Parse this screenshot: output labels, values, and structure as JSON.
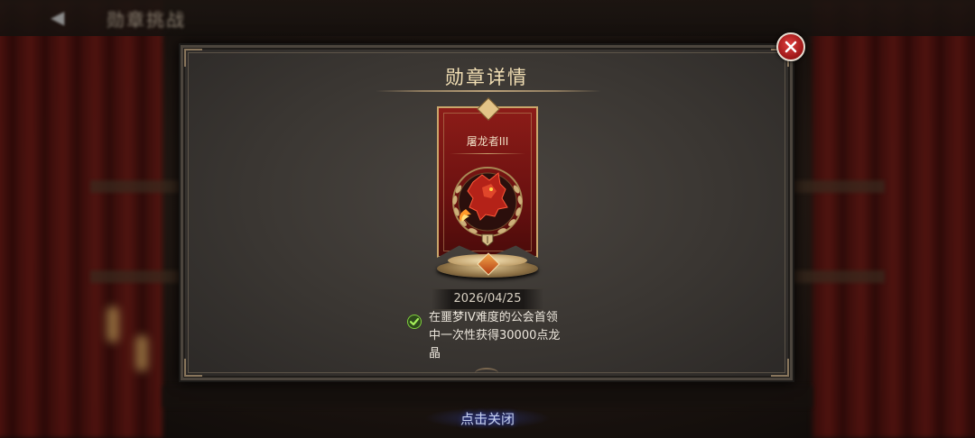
{
  "background": {
    "back_label": "◀",
    "page_title": "勋章挑战"
  },
  "dialog": {
    "title": "勋章详情",
    "close_icon": "close-icon",
    "medal": {
      "name": "屠龙者III",
      "emblem_icon": "red-dragon-emblem-icon"
    },
    "date": "2026/04/25",
    "condition": {
      "completed": true,
      "check_icon": "check-icon",
      "line1": "在噩梦IV难度的公会首领",
      "line2": "中一次性获得30000点龙",
      "line3": "晶"
    }
  },
  "footer": {
    "tap_to_close": "点击关闭"
  },
  "colors": {
    "title_gold": "#f2dfb4",
    "close_red": "#c62828",
    "banner_red": "#8c1c18",
    "check_green": "#5cb82c",
    "tap_close_blue": "#c8d2ee"
  }
}
